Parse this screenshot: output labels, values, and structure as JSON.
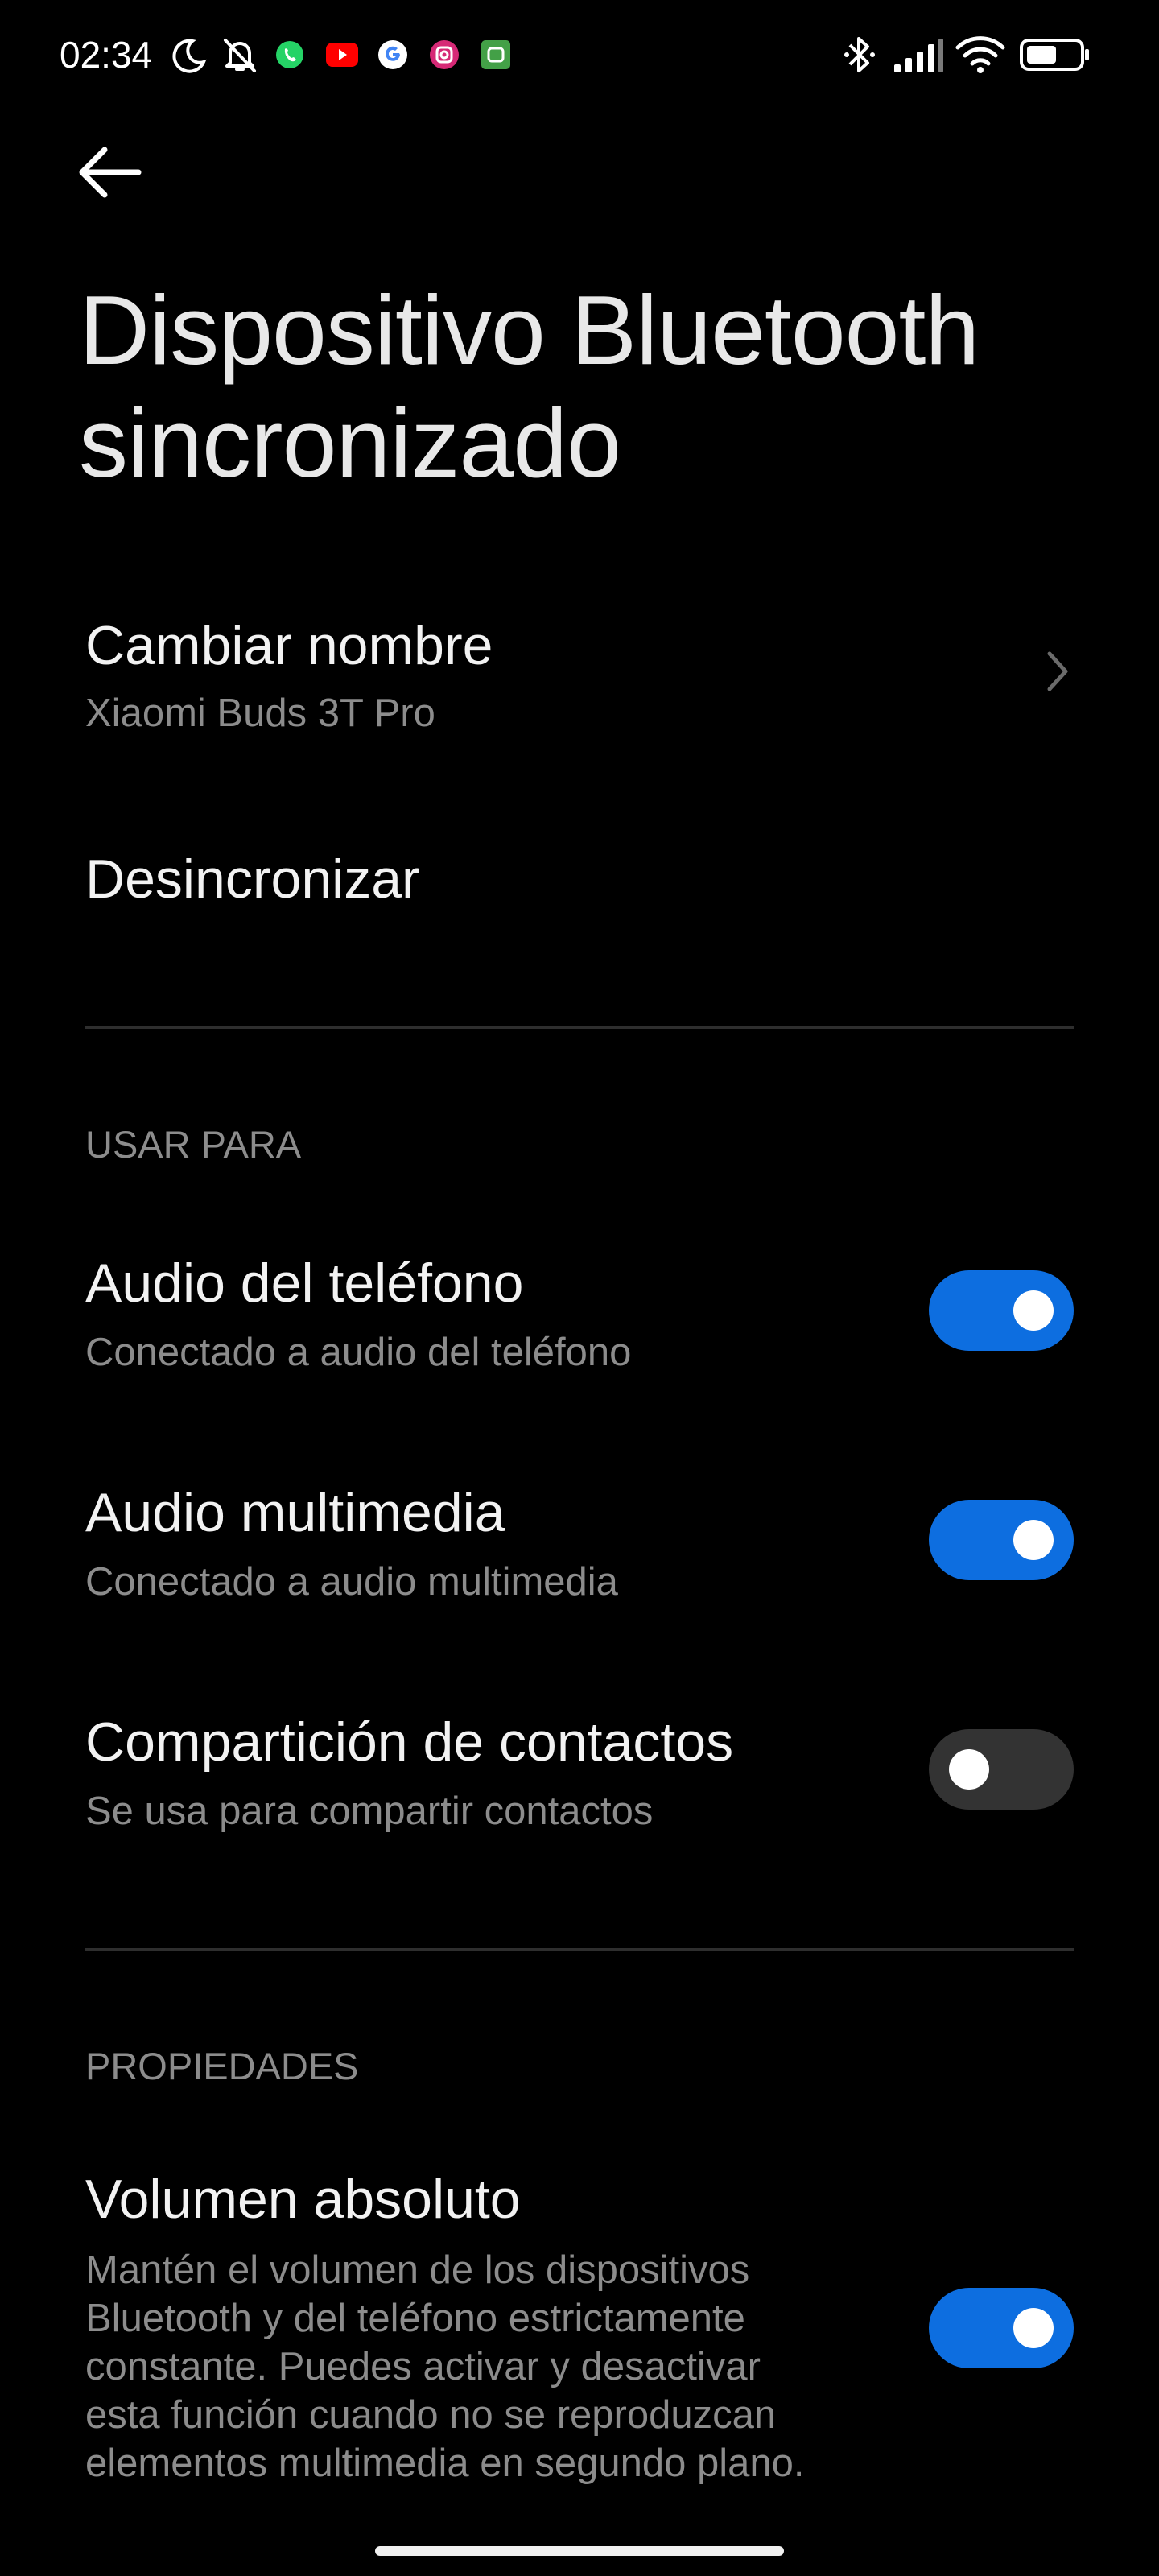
{
  "status_bar": {
    "time": "02:34",
    "notification_icons": [
      "moon-icon",
      "bell-off-icon",
      "whatsapp-icon",
      "youtube-icon",
      "google-icon",
      "instagram-icon",
      "app-icon"
    ],
    "system_icons": [
      "bluetooth-icon",
      "signal-icon",
      "wifi-icon",
      "battery-icon"
    ]
  },
  "header": {
    "title": "Dispositivo Bluetooth sincronizado"
  },
  "device": {
    "rename_label": "Cambiar nombre",
    "device_name": "Xiaomi Buds 3T Pro",
    "unpair_label": "Desincronizar"
  },
  "use_for": {
    "section_label": "USAR PARA",
    "items": [
      {
        "title": "Audio del teléfono",
        "subtitle": "Conectado a audio del teléfono",
        "enabled": true
      },
      {
        "title": "Audio multimedia",
        "subtitle": "Conectado a audio multimedia",
        "enabled": true
      },
      {
        "title": "Compartición de contactos",
        "subtitle": "Se usa para compartir contactos",
        "enabled": false
      }
    ]
  },
  "properties": {
    "section_label": "PROPIEDADES",
    "absolute_volume": {
      "title": "Volumen absoluto",
      "description_lines": [
        "Mantén el volumen de los dispositivos",
        "Bluetooth y del teléfono estrictamente",
        "constante. Puedes activar y desactivar",
        "esta función cuando no se reproduzcan",
        "elementos multimedia en segundo plano."
      ],
      "enabled": true
    }
  },
  "colors": {
    "background": "#000000",
    "toggle_on": "#0d6ee0",
    "toggle_off": "#333333",
    "secondary_text": "#8c8c8c"
  }
}
